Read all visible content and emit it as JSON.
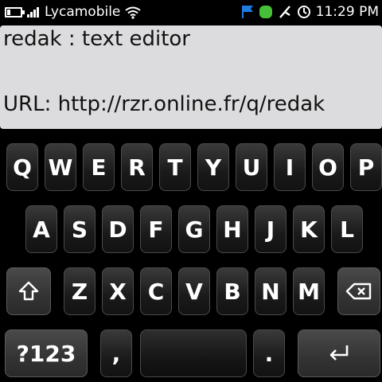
{
  "status_bar": {
    "carrier": "Lycamobile",
    "time": "11:29 PM",
    "icons": [
      "battery-icon",
      "signal-icon",
      "wifi-icon",
      "flag-icon",
      "green-dot-icon",
      "bluetooth-icon",
      "alarm-clock-icon"
    ],
    "battery_level": 0.25
  },
  "editor": {
    "lines": [
      "redak : text editor",
      "URL: http://rzr.online.fr/q/redak"
    ]
  },
  "keyboard": {
    "row1": [
      "Q",
      "W",
      "E",
      "R",
      "T",
      "Y",
      "U",
      "I",
      "O",
      "P"
    ],
    "row2": [
      "A",
      "S",
      "D",
      "F",
      "G",
      "H",
      "J",
      "K",
      "L"
    ],
    "row3": [
      "Z",
      "X",
      "C",
      "V",
      "B",
      "N",
      "M"
    ],
    "symbols_label": "?123",
    "comma_label": ",",
    "period_label": ".",
    "shift_icon": "shift-icon",
    "backspace_icon": "backspace-icon",
    "enter_icon": "enter-icon"
  },
  "colors": {
    "status_bar_bg": "#000000",
    "editor_bg": "#dcdcde",
    "key_bg": "#1e1e1e",
    "key_text": "#ffffff"
  }
}
